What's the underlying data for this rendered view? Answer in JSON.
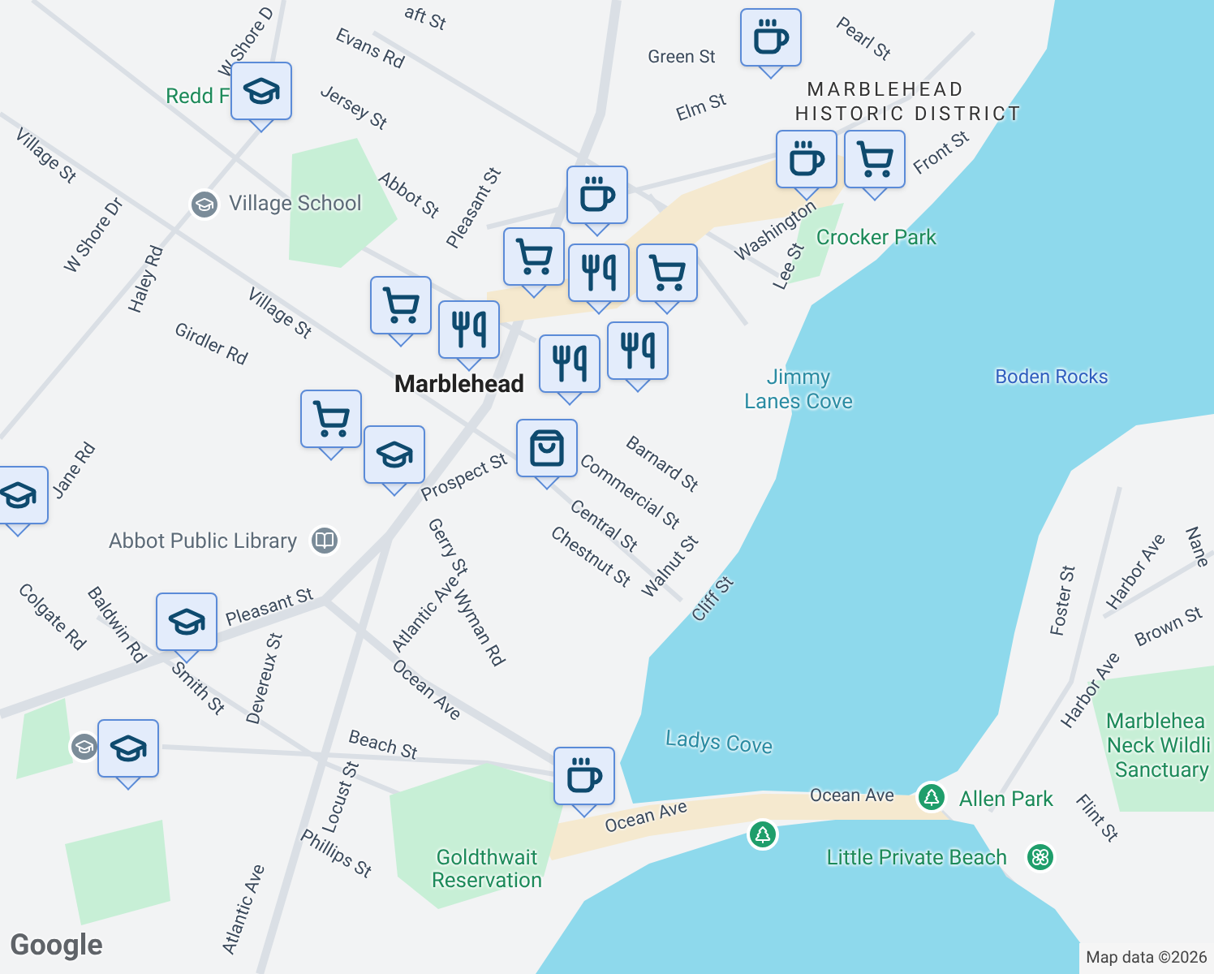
{
  "labels": [
    {
      "text": "aft St",
      "kind": "street"
    },
    {
      "text": "Evans Rd",
      "kind": "street"
    },
    {
      "text": "W Shore D",
      "kind": "street"
    },
    {
      "text": "Redd F",
      "kind": "park"
    },
    {
      "text": "Jersey St",
      "kind": "street"
    },
    {
      "text": "Green St",
      "kind": "street"
    },
    {
      "text": "Pearl St",
      "kind": "street"
    },
    {
      "text": "Elm St",
      "kind": "street"
    },
    {
      "text": "MARBLEHEAD",
      "kind": "district"
    },
    {
      "text": "HISTORIC DISTRICT",
      "kind": "district"
    },
    {
      "text": "Village St",
      "kind": "street"
    },
    {
      "text": "W Shore Dr",
      "kind": "street"
    },
    {
      "text": "Village School",
      "kind": "poi"
    },
    {
      "text": "Abbot St",
      "kind": "street"
    },
    {
      "text": "Haley Rd",
      "kind": "street"
    },
    {
      "text": "Village St",
      "kind": "street"
    },
    {
      "text": "Girdler Rd",
      "kind": "street"
    },
    {
      "text": "Pleasant St",
      "kind": "street"
    },
    {
      "text": "Marblehead",
      "kind": "town"
    },
    {
      "text": "Washington",
      "kind": "street"
    },
    {
      "text": "Front St",
      "kind": "street"
    },
    {
      "text": "Crocker Park",
      "kind": "park"
    },
    {
      "text": "Lee St",
      "kind": "street"
    },
    {
      "text": "Jimmy",
      "kind": "water"
    },
    {
      "text": "Lanes Cove",
      "kind": "water"
    },
    {
      "text": "Boden Rocks",
      "kind": "rock"
    },
    {
      "text": "Barnard St",
      "kind": "street"
    },
    {
      "text": "Commercial St",
      "kind": "street"
    },
    {
      "text": "Prospect St",
      "kind": "street"
    },
    {
      "text": "Central St",
      "kind": "street"
    },
    {
      "text": "Chestnut St",
      "kind": "street"
    },
    {
      "text": "Walnut St",
      "kind": "street"
    },
    {
      "text": "Cliff St",
      "kind": "street"
    },
    {
      "text": "Jane Rd",
      "kind": "street"
    },
    {
      "text": "Abbot Public Library",
      "kind": "poi"
    },
    {
      "text": "Gerry St",
      "kind": "street"
    },
    {
      "text": "Colgate Rd",
      "kind": "street"
    },
    {
      "text": "Baldwin Rd",
      "kind": "street"
    },
    {
      "text": "Pleasant St",
      "kind": "street"
    },
    {
      "text": "Smith St",
      "kind": "street"
    },
    {
      "text": "Devereux St",
      "kind": "street"
    },
    {
      "text": "Atlantic Ave",
      "kind": "street"
    },
    {
      "text": "Wyman Rd",
      "kind": "street"
    },
    {
      "text": "Ocean Ave",
      "kind": "street"
    },
    {
      "text": "Beach St",
      "kind": "street"
    },
    {
      "text": "Locust St",
      "kind": "street"
    },
    {
      "text": "Phillips St",
      "kind": "street"
    },
    {
      "text": "Goldthwait",
      "kind": "park"
    },
    {
      "text": "Reservation",
      "kind": "park"
    },
    {
      "text": "Atlantic Ave",
      "kind": "street"
    },
    {
      "text": "Ladys Cove",
      "kind": "water"
    },
    {
      "text": "Ocean Ave",
      "kind": "street"
    },
    {
      "text": "Ocean Ave",
      "kind": "street"
    },
    {
      "text": "Allen Park",
      "kind": "park"
    },
    {
      "text": "Little Private Beach",
      "kind": "park"
    },
    {
      "text": "Foster St",
      "kind": "street"
    },
    {
      "text": "Harbor Ave",
      "kind": "street"
    },
    {
      "text": "Harbor Ave",
      "kind": "street"
    },
    {
      "text": "Brown St",
      "kind": "street"
    },
    {
      "text": "Nane",
      "kind": "street"
    },
    {
      "text": "Marblehea",
      "kind": "park"
    },
    {
      "text": "Neck Wildli",
      "kind": "park"
    },
    {
      "text": "Sanctuary",
      "kind": "park"
    },
    {
      "text": "Flint St",
      "kind": "street"
    }
  ],
  "pois": [
    {
      "kind": "school"
    },
    {
      "kind": "library"
    },
    {
      "kind": "school"
    },
    {
      "kind": "tree"
    },
    {
      "kind": "tree"
    },
    {
      "kind": "flower"
    }
  ],
  "markers": [
    {
      "kind": "school"
    },
    {
      "kind": "coffee"
    },
    {
      "kind": "cart"
    },
    {
      "kind": "coffee"
    },
    {
      "kind": "coffee"
    },
    {
      "kind": "cart"
    },
    {
      "kind": "utensils"
    },
    {
      "kind": "cart"
    },
    {
      "kind": "utensils"
    },
    {
      "kind": "cart"
    },
    {
      "kind": "utensils"
    },
    {
      "kind": "utensils"
    },
    {
      "kind": "bag"
    },
    {
      "kind": "cart"
    },
    {
      "kind": "school"
    },
    {
      "kind": "school"
    },
    {
      "kind": "school"
    },
    {
      "kind": "school"
    },
    {
      "kind": "coffee"
    }
  ],
  "logo": "Google",
  "attribution": "Map data ©2026"
}
